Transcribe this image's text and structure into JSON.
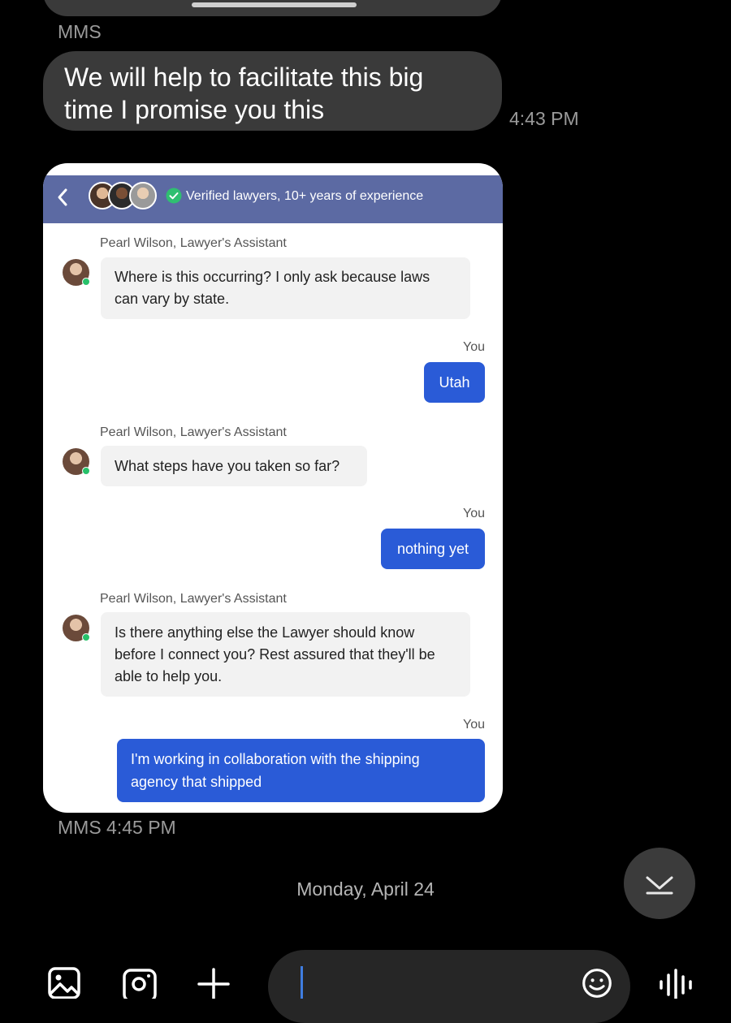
{
  "thread": {
    "top_label": "MMS",
    "message1": {
      "text_line1": "We will help to facilitate this big",
      "text_line2": "time I promise you this",
      "time": "4:43 PM"
    },
    "attachment_meta": "MMS 4:45 PM",
    "date_separator": "Monday, April 24"
  },
  "screenshot": {
    "header_text": "Verified lawyers, 10+ years of experience",
    "messages": [
      {
        "sender": "Pearl Wilson, Lawyer's Assistant",
        "line1": "Where is this occurring? I only ask because laws",
        "line2": "can vary by state."
      },
      {
        "sender": "You",
        "text": "Utah"
      },
      {
        "sender": "Pearl Wilson, Lawyer's Assistant",
        "text": "What steps have you taken so far?"
      },
      {
        "sender": "You",
        "text": "nothing yet"
      },
      {
        "sender": "Pearl Wilson, Lawyer's Assistant",
        "line1": "Is there anything else the Lawyer should know",
        "line2": "before I connect you? Rest assured that they'll be",
        "line3": "able to help you."
      },
      {
        "sender": "You",
        "line1": "I'm working in collaboration with the shipping",
        "line2": "agency that shipped"
      }
    ]
  },
  "icons": {
    "gallery": "gallery-icon",
    "camera": "camera-icon",
    "add": "plus-icon",
    "emoji": "emoji-icon",
    "voice": "voice-wave-icon",
    "scroll_down": "chevron-down-icon",
    "back": "chevron-left-icon",
    "verified": "verified-shield-icon"
  },
  "colors": {
    "background": "#000000",
    "incoming_bubble": "#3a3a3a",
    "header_bar": "#5c6aa3",
    "outgoing_chat": "#2a5bd7",
    "online_dot": "#27c16a",
    "cursor": "#3f7de0"
  }
}
